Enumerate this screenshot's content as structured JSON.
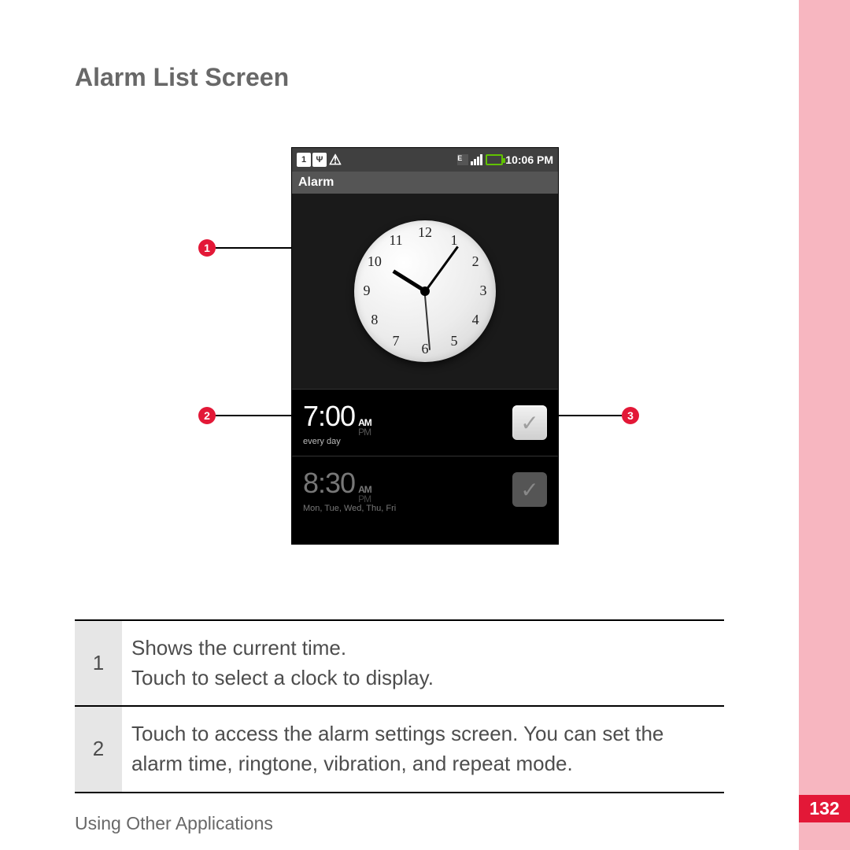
{
  "section_title": "Alarm List Screen",
  "footer": "Using Other Applications",
  "page_number": "132",
  "phone": {
    "status": {
      "time": "10:06 PM",
      "sim_label": "1",
      "usb_label": "Ψ",
      "warn_label": "⚠",
      "data_label": "E"
    },
    "title_bar": "Alarm",
    "clock_numbers": [
      "12",
      "1",
      "2",
      "3",
      "4",
      "5",
      "6",
      "7",
      "8",
      "9",
      "10",
      "11"
    ],
    "alarms": [
      {
        "time": "7:00",
        "am": "AM",
        "pm": "PM",
        "days": "every day",
        "enabled": true,
        "dim": false
      },
      {
        "time": "8:30",
        "am": "AM",
        "pm": "PM",
        "days": "Mon, Tue, Wed, Thu, Fri",
        "enabled": false,
        "dim": true
      }
    ]
  },
  "callouts": {
    "c1": "1",
    "c2": "2",
    "c3": "3"
  },
  "table": {
    "rows": [
      {
        "idx": "1",
        "text": "Shows the current time.\nTouch to select a clock to display."
      },
      {
        "idx": "2",
        "text": "Touch to access the alarm settings screen. You can set the alarm time, ringtone, vibration, and repeat mode."
      }
    ]
  }
}
